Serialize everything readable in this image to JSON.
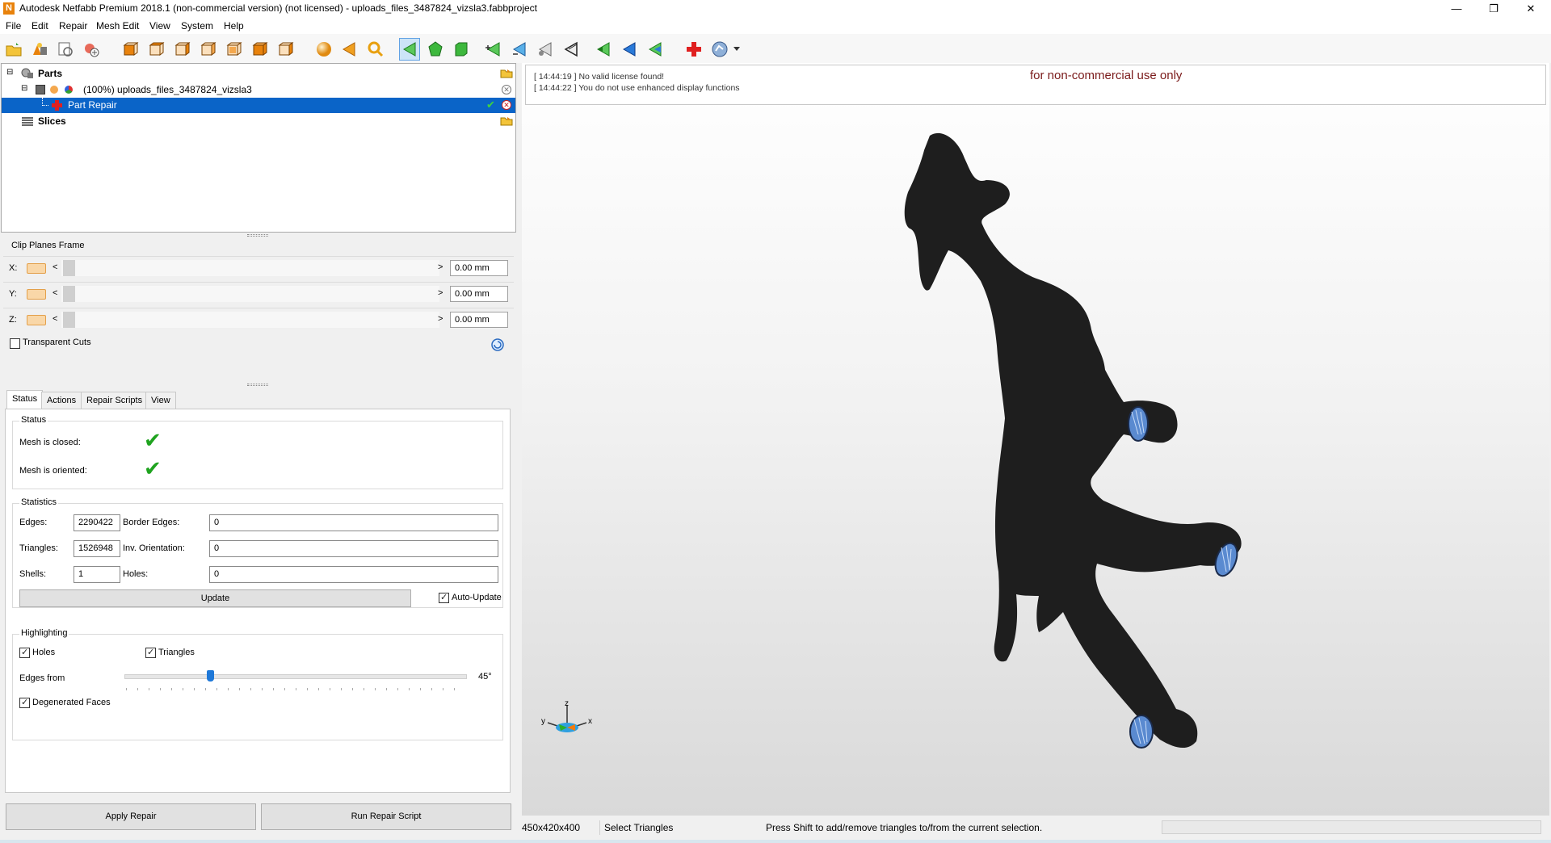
{
  "window": {
    "title": "Autodesk Netfabb Premium 2018.1 (non-commercial version) (not licensed) - uploads_files_3487824_vizsla3.fabbproject",
    "logo_letter": "N",
    "minimize": "—",
    "maximize": "❐",
    "close": "✕"
  },
  "menu": [
    "File",
    "Edit",
    "Repair",
    "Mesh Edit",
    "View",
    "System",
    "Help"
  ],
  "toolbar_icons": [
    "open-project-icon",
    "add-part-icon",
    "add-support-icon",
    "add-slice-icon",
    "view-front-icon",
    "view-back-icon",
    "view-left-icon",
    "view-right-icon",
    "view-top-icon",
    "view-bottom-icon",
    "view-iso-icon",
    "sphere-icon",
    "arrow-left-icon",
    "zoom-icon",
    "select-triangle-icon",
    "select-surface-icon",
    "select-shell-icon",
    "add-triangle-icon",
    "extend-selection-icon",
    "shrink-selection-icon",
    "invert-selection-icon",
    "undo-icon",
    "redo-icon",
    "mark-icon",
    "new-repair-icon",
    "repair-menu-icon"
  ],
  "tree": {
    "parts_label": "Parts",
    "part_label": "(100%) uploads_files_3487824_vizsla3",
    "repair_label": "Part Repair",
    "slices_label": "Slices"
  },
  "clip": {
    "title": "Clip Planes Frame",
    "x_label": "X:",
    "y_label": "Y:",
    "z_label": "Z:",
    "left_arrow": "<",
    "right_arrow": ">",
    "x_value": "0.00 mm",
    "y_value": "0.00 mm",
    "z_value": "0.00 mm",
    "transparent_cuts": "Transparent Cuts"
  },
  "tabs": [
    "Status",
    "Actions",
    "Repair Scripts",
    "View"
  ],
  "status_group": {
    "title": "Status",
    "closed_label": "Mesh is closed:",
    "oriented_label": "Mesh is oriented:",
    "check": "✔"
  },
  "statistics": {
    "title": "Statistics",
    "edges_label": "Edges:",
    "edges": "2290422",
    "border_edges_label": "Border Edges:",
    "border_edges": "0",
    "triangles_label": "Triangles:",
    "triangles": "1526948",
    "inv_orientation_label": "Inv. Orientation:",
    "inv_orientation": "0",
    "shells_label": "Shells:",
    "shells": "1",
    "holes_label": "Holes:",
    "holes": "0",
    "update_label": "Update",
    "auto_update_label": "Auto-Update"
  },
  "highlighting": {
    "title": "Highlighting",
    "holes_label": "Holes",
    "triangles_label": "Triangles",
    "edges_from_label": "Edges from",
    "edges_from_value": "45°",
    "degenerated_label": "Degenerated Faces"
  },
  "bottom_buttons": {
    "apply_repair": "Apply Repair",
    "run_script": "Run Repair Script"
  },
  "viewport": {
    "log": [
      "[ 14:44:19 ] No valid license found!",
      "[ 14:44:22 ] You do not use enhanced display functions"
    ],
    "noncommercial": "for non-commercial use only",
    "axis_z": "z",
    "axis_y": "y",
    "axis_x": "x"
  },
  "statusbar": {
    "dimensions": "450x420x400",
    "mode": "Select Triangles",
    "hint": "Press Shift to add/remove triangles to/from the current selection."
  },
  "colors": {
    "selection": "#0a64c8",
    "model": "#1e1e1e",
    "paw_highlight": "#5a8ad0",
    "check_green": "#1fa31f",
    "accent_orange": "#e8820c"
  }
}
